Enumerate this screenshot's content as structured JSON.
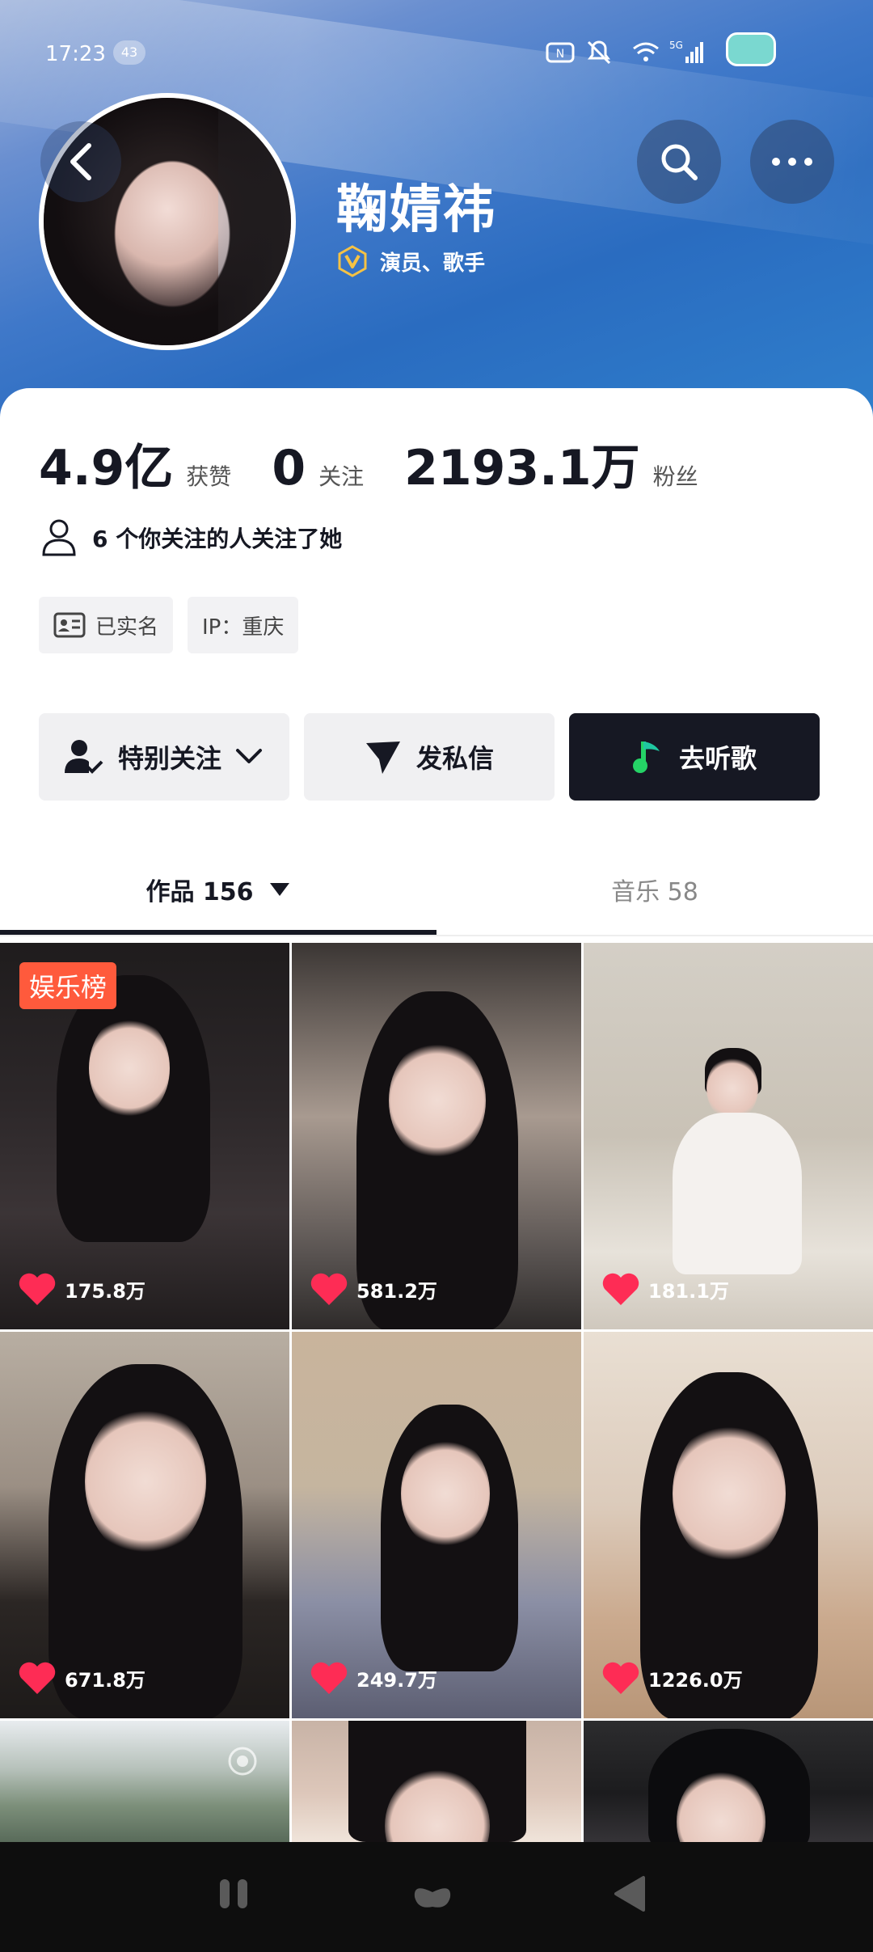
{
  "status_bar": {
    "time": "17:23",
    "notification_count": "43",
    "network": "5G"
  },
  "profile": {
    "name": "鞠婧祎",
    "verification": "演员、歌手"
  },
  "stats": {
    "likes_value": "4.9亿",
    "likes_label": "获赞",
    "following_value": "0",
    "following_label": "关注",
    "followers_value": "2193.1万",
    "followers_label": "粉丝"
  },
  "mutual": {
    "text": "6 个你关注的人关注了她"
  },
  "tags": {
    "real_name": "已实名",
    "ip": "IP：重庆"
  },
  "actions": {
    "follow": "特别关注",
    "message": "发私信",
    "music": "去听歌"
  },
  "tabs": {
    "works": "作品 156",
    "music": "音乐 58"
  },
  "grid": {
    "ranking_badge": "娱乐榜",
    "items": [
      {
        "likes": "175.8万"
      },
      {
        "likes": "581.2万"
      },
      {
        "likes": "181.1万"
      },
      {
        "likes": "671.8万"
      },
      {
        "likes": "249.7万"
      },
      {
        "likes": "1226.0万"
      }
    ]
  },
  "colors": {
    "accent_dark": "#161823",
    "heart": "#fe2c55",
    "badge": "#ff5a3c"
  }
}
